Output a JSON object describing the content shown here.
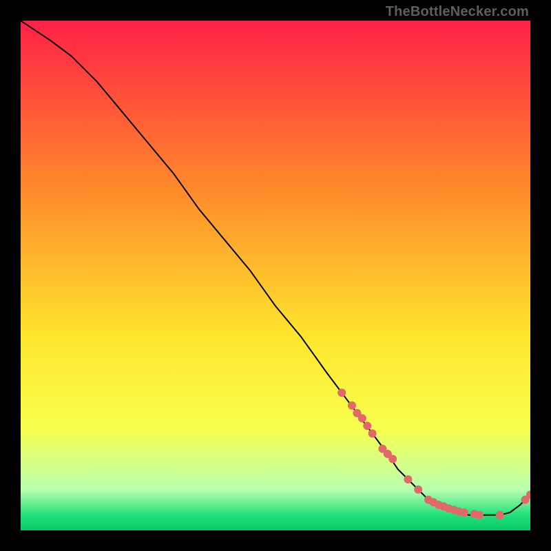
{
  "watermark": "TheBottleNecker.com",
  "gradient": {
    "top": "#ff2147",
    "upper_mid": "#ff8a2a",
    "mid": "#ffe62e",
    "lower_mid": "#f7ff4d",
    "green_light": "#baffb0",
    "green": "#1fe07a",
    "green_dark": "#0cc96a"
  },
  "chart_data": {
    "type": "line",
    "title": "",
    "xlabel": "",
    "ylabel": "",
    "xlim": [
      0,
      100
    ],
    "ylim": [
      0,
      100
    ],
    "series": [
      {
        "name": "curve",
        "x": [
          0,
          3,
          6,
          10,
          15,
          20,
          25,
          30,
          35,
          40,
          45,
          50,
          55,
          60,
          63,
          66,
          69,
          72,
          74,
          76,
          78,
          80,
          82,
          84,
          86,
          88,
          90,
          92,
          94,
          96,
          98,
          100
        ],
        "y": [
          100,
          98,
          96,
          93,
          88,
          82,
          76,
          70,
          63,
          57,
          51,
          44,
          38,
          31,
          27,
          23,
          19,
          15,
          12,
          10,
          8,
          6,
          5,
          4,
          3.5,
          3,
          3,
          3,
          3,
          3.5,
          5,
          7
        ]
      },
      {
        "name": "markers",
        "x": [
          63,
          65,
          66,
          67,
          68,
          69,
          71,
          72,
          73,
          76,
          78,
          80,
          81,
          82,
          83,
          84,
          85,
          86,
          87,
          89,
          90,
          94,
          99,
          100
        ],
        "y": [
          27,
          24.5,
          23,
          22,
          20.5,
          19,
          16,
          15,
          14,
          10,
          8,
          6,
          5.5,
          5,
          4.7,
          4.3,
          4,
          3.7,
          3.5,
          3.2,
          3,
          3,
          6,
          7
        ]
      }
    ],
    "marker_color": "#e06a6a",
    "line_color": "#000000"
  }
}
